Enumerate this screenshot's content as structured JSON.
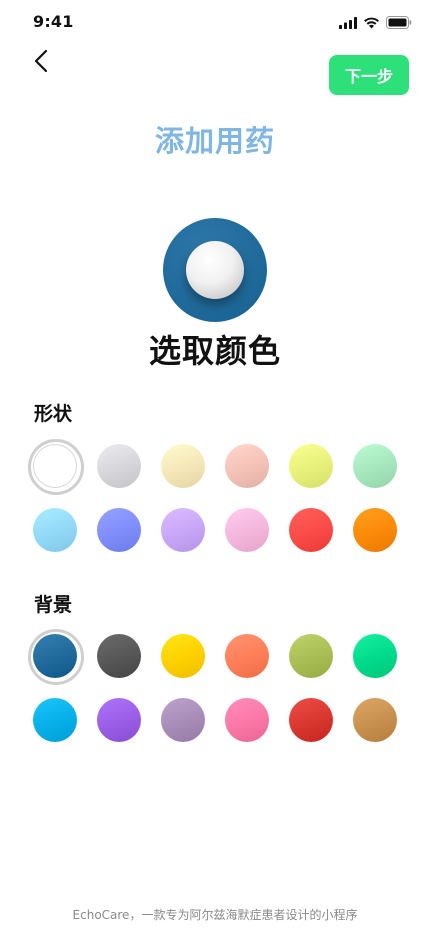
{
  "status_bar": {
    "time": "9:41",
    "icons": [
      "signal-icon",
      "wifi-icon",
      "battery-icon"
    ]
  },
  "header": {
    "back_icon": "chevron-left-icon",
    "next_label": "下一步",
    "title": "添加用药"
  },
  "preview": {
    "background_color": "#1f6a9a",
    "shape_color": "#ffffff"
  },
  "section_heading": "选取颜色",
  "shape": {
    "label": "形状",
    "selected_index": 0,
    "colors": [
      "#ffffff",
      "#d6d6da",
      "#f5e6b8",
      "#f4c1b6",
      "#e6f07a",
      "#a6e6bd",
      "#92d8f7",
      "#7f8dfb",
      "#c7a6f7",
      "#f4b6db",
      "#fa4b47",
      "#fb8a08"
    ]
  },
  "background": {
    "label": "背景",
    "selected_index": 0,
    "colors": [
      "#1f6a9a",
      "#565656",
      "#fed000",
      "#fe7e58",
      "#a8be55",
      "#00da8a",
      "#07afe8",
      "#9a5ee6",
      "#a88cb8",
      "#fb77a6",
      "#d8372f",
      "#c8904f"
    ]
  },
  "footer": "EchoCare，一款专为阿尔兹海默症患者设计的小程序"
}
